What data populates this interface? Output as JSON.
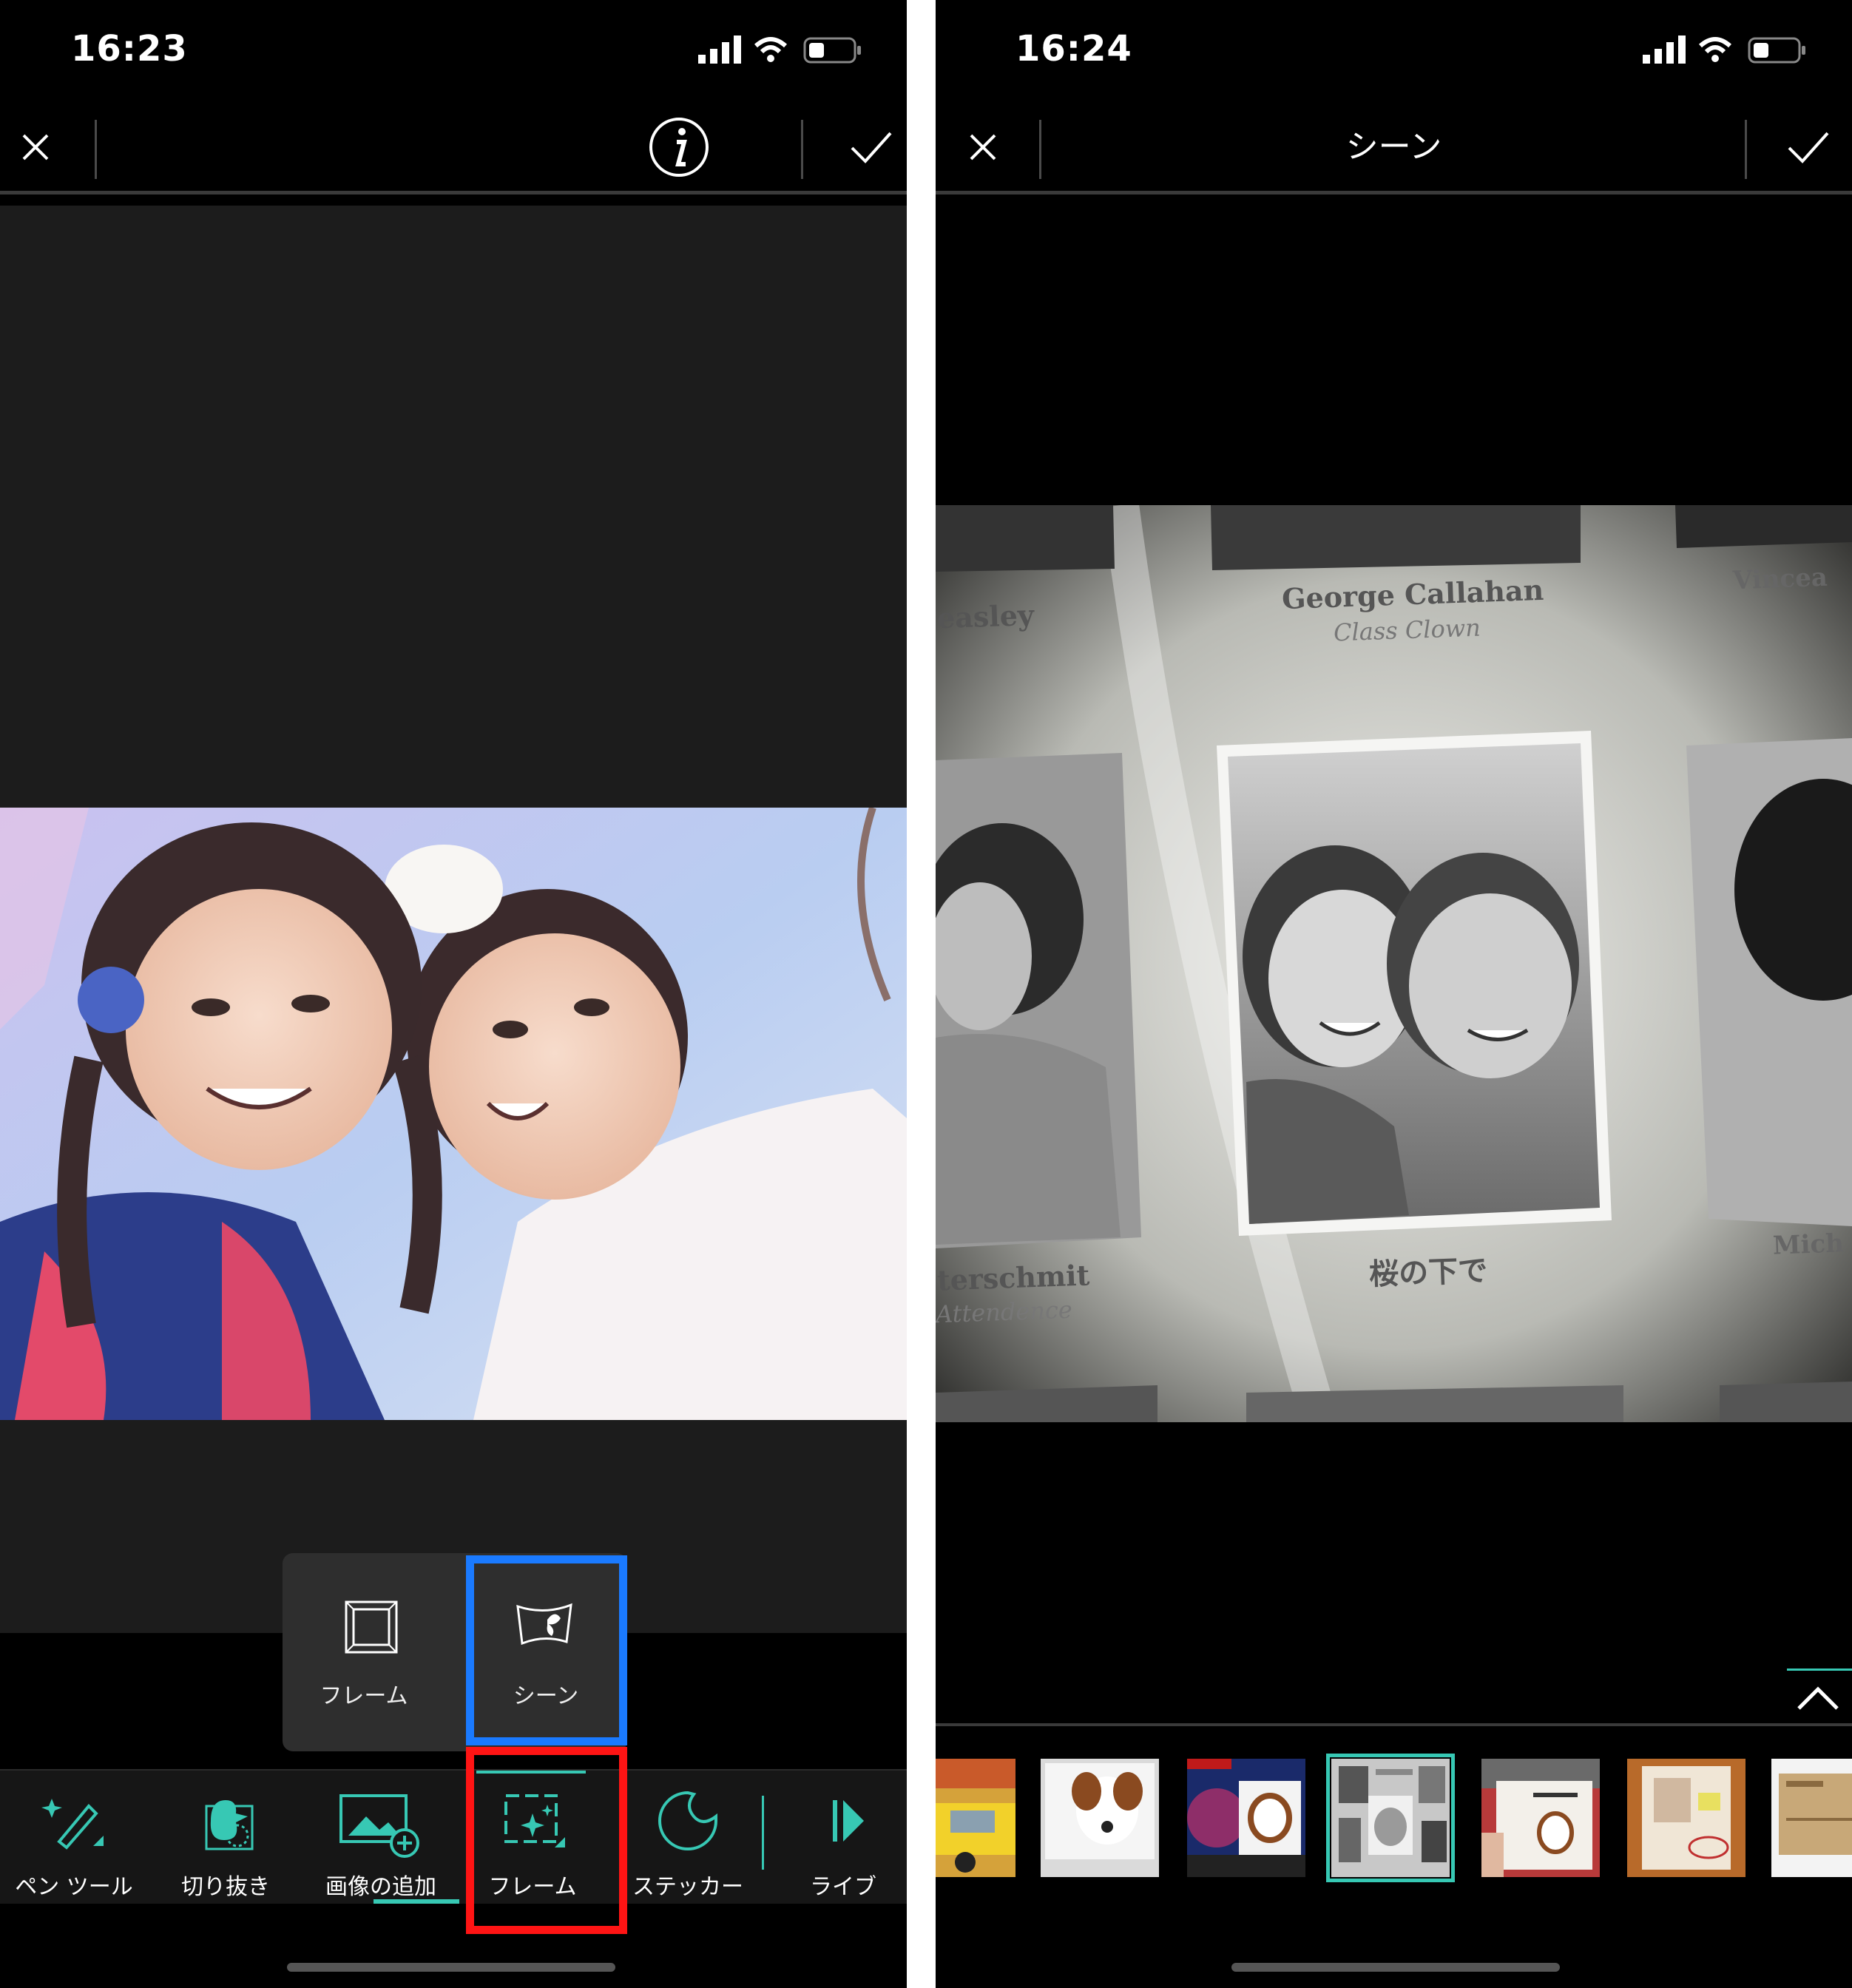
{
  "left_screen": {
    "status": {
      "time": "16:23"
    },
    "popup": {
      "items": [
        {
          "icon": "frame-icon",
          "label": "フレーム"
        },
        {
          "icon": "scene-icon",
          "label": "シーン"
        }
      ]
    },
    "toolbar": {
      "items": [
        {
          "icon": "pen-tool-icon",
          "label": "ペン ツール"
        },
        {
          "icon": "cutout-icon",
          "label": "切り抜き"
        },
        {
          "icon": "add-image-icon",
          "label": "画像の追加"
        },
        {
          "icon": "frame-sparkle-icon",
          "label": "フレーム"
        },
        {
          "icon": "sticker-icon",
          "label": "ステッカー"
        },
        {
          "icon": "live-icon",
          "label": "ライブ"
        }
      ]
    }
  },
  "right_screen": {
    "status": {
      "time": "16:24"
    },
    "title": "シーン",
    "scene": {
      "name_top_left": "easley",
      "name_top_center": "George Callahan",
      "subtitle_top_center": "Class Clown",
      "name_top_right": "Vincea",
      "name_bottom_left": "terschmit",
      "subtitle_bottom_left": "Attendence",
      "center_caption": "桜の下で",
      "name_bottom_right": "Mich"
    },
    "thumbnails": [
      {
        "name": "taxi"
      },
      {
        "name": "dog-hanging"
      },
      {
        "name": "breaking-news"
      },
      {
        "name": "yearbook",
        "selected": true
      },
      {
        "name": "war-and-peace"
      },
      {
        "name": "documents"
      },
      {
        "name": "postcard"
      }
    ],
    "colors": {
      "accent": "#37c8b4"
    }
  },
  "colors": {
    "highlight_blue": "#1a7aff",
    "highlight_red": "#ff1414",
    "accent": "#37c8b4"
  }
}
